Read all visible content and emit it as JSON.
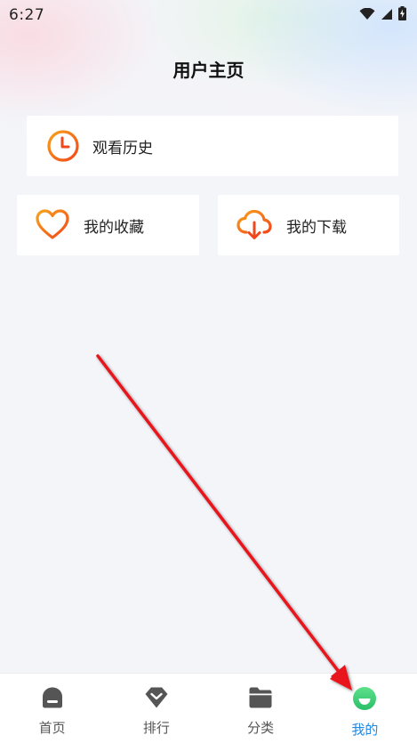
{
  "status_bar": {
    "time": "6:27",
    "icons": [
      "wifi-icon",
      "cellular-icon",
      "battery-charging-icon"
    ]
  },
  "page": {
    "title": "用户主页"
  },
  "cards": {
    "history": {
      "label": "观看历史",
      "icon": "clock-icon"
    },
    "favorites": {
      "label": "我的收藏",
      "icon": "heart-icon"
    },
    "downloads": {
      "label": "我的下载",
      "icon": "cloud-download-icon"
    }
  },
  "tab_bar": {
    "tabs": [
      {
        "label": "首页",
        "icon": "home-icon",
        "active": false
      },
      {
        "label": "排行",
        "icon": "ranking-icon",
        "active": false
      },
      {
        "label": "分类",
        "icon": "folder-icon",
        "active": false
      },
      {
        "label": "我的",
        "icon": "profile-face-icon",
        "active": true
      }
    ]
  },
  "colors": {
    "accent_orange": "#f26a1b",
    "accent_orange_light": "#f7a21b",
    "tab_inactive_icon": "#555555",
    "tab_active_label": "#1e88e5",
    "tab_active_icon": "#3ecf73",
    "annotation_arrow": "#e8141b"
  }
}
